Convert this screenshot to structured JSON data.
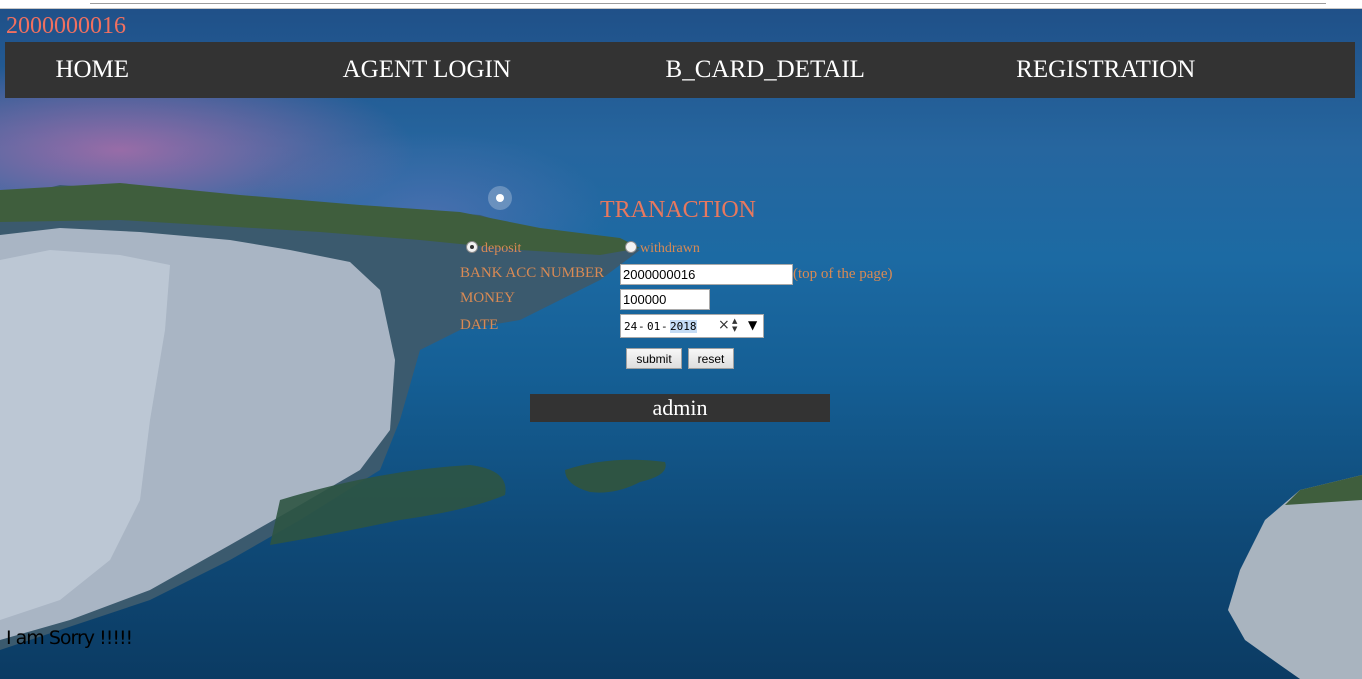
{
  "header": {
    "account_id": "2000000016"
  },
  "nav": {
    "items": [
      {
        "label": "HOME"
      },
      {
        "label": "AGENT LOGIN"
      },
      {
        "label": "B_CARD_DETAIL"
      },
      {
        "label": "REGISTRATION"
      }
    ]
  },
  "form": {
    "title": "TRANACTION",
    "type_options": [
      {
        "label": "deposit",
        "checked": true
      },
      {
        "label": "withdrawn",
        "checked": false
      }
    ],
    "bank_acc_label": "BANK ACC NUMBER",
    "bank_acc_value": "2000000016",
    "bank_acc_hint": "(top of the page)",
    "money_label": "MONEY",
    "money_value": "100000",
    "date_label": "DATE",
    "date_day": "24",
    "date_month": "01",
    "date_year": "2018",
    "submit_label": "submit",
    "reset_label": "reset"
  },
  "admin_label": "admin",
  "footer_message": "I am Sorry !!!!!",
  "colors": {
    "nav_bg": "#333333",
    "accent_text": "#f07060",
    "form_text": "#d98a54"
  }
}
